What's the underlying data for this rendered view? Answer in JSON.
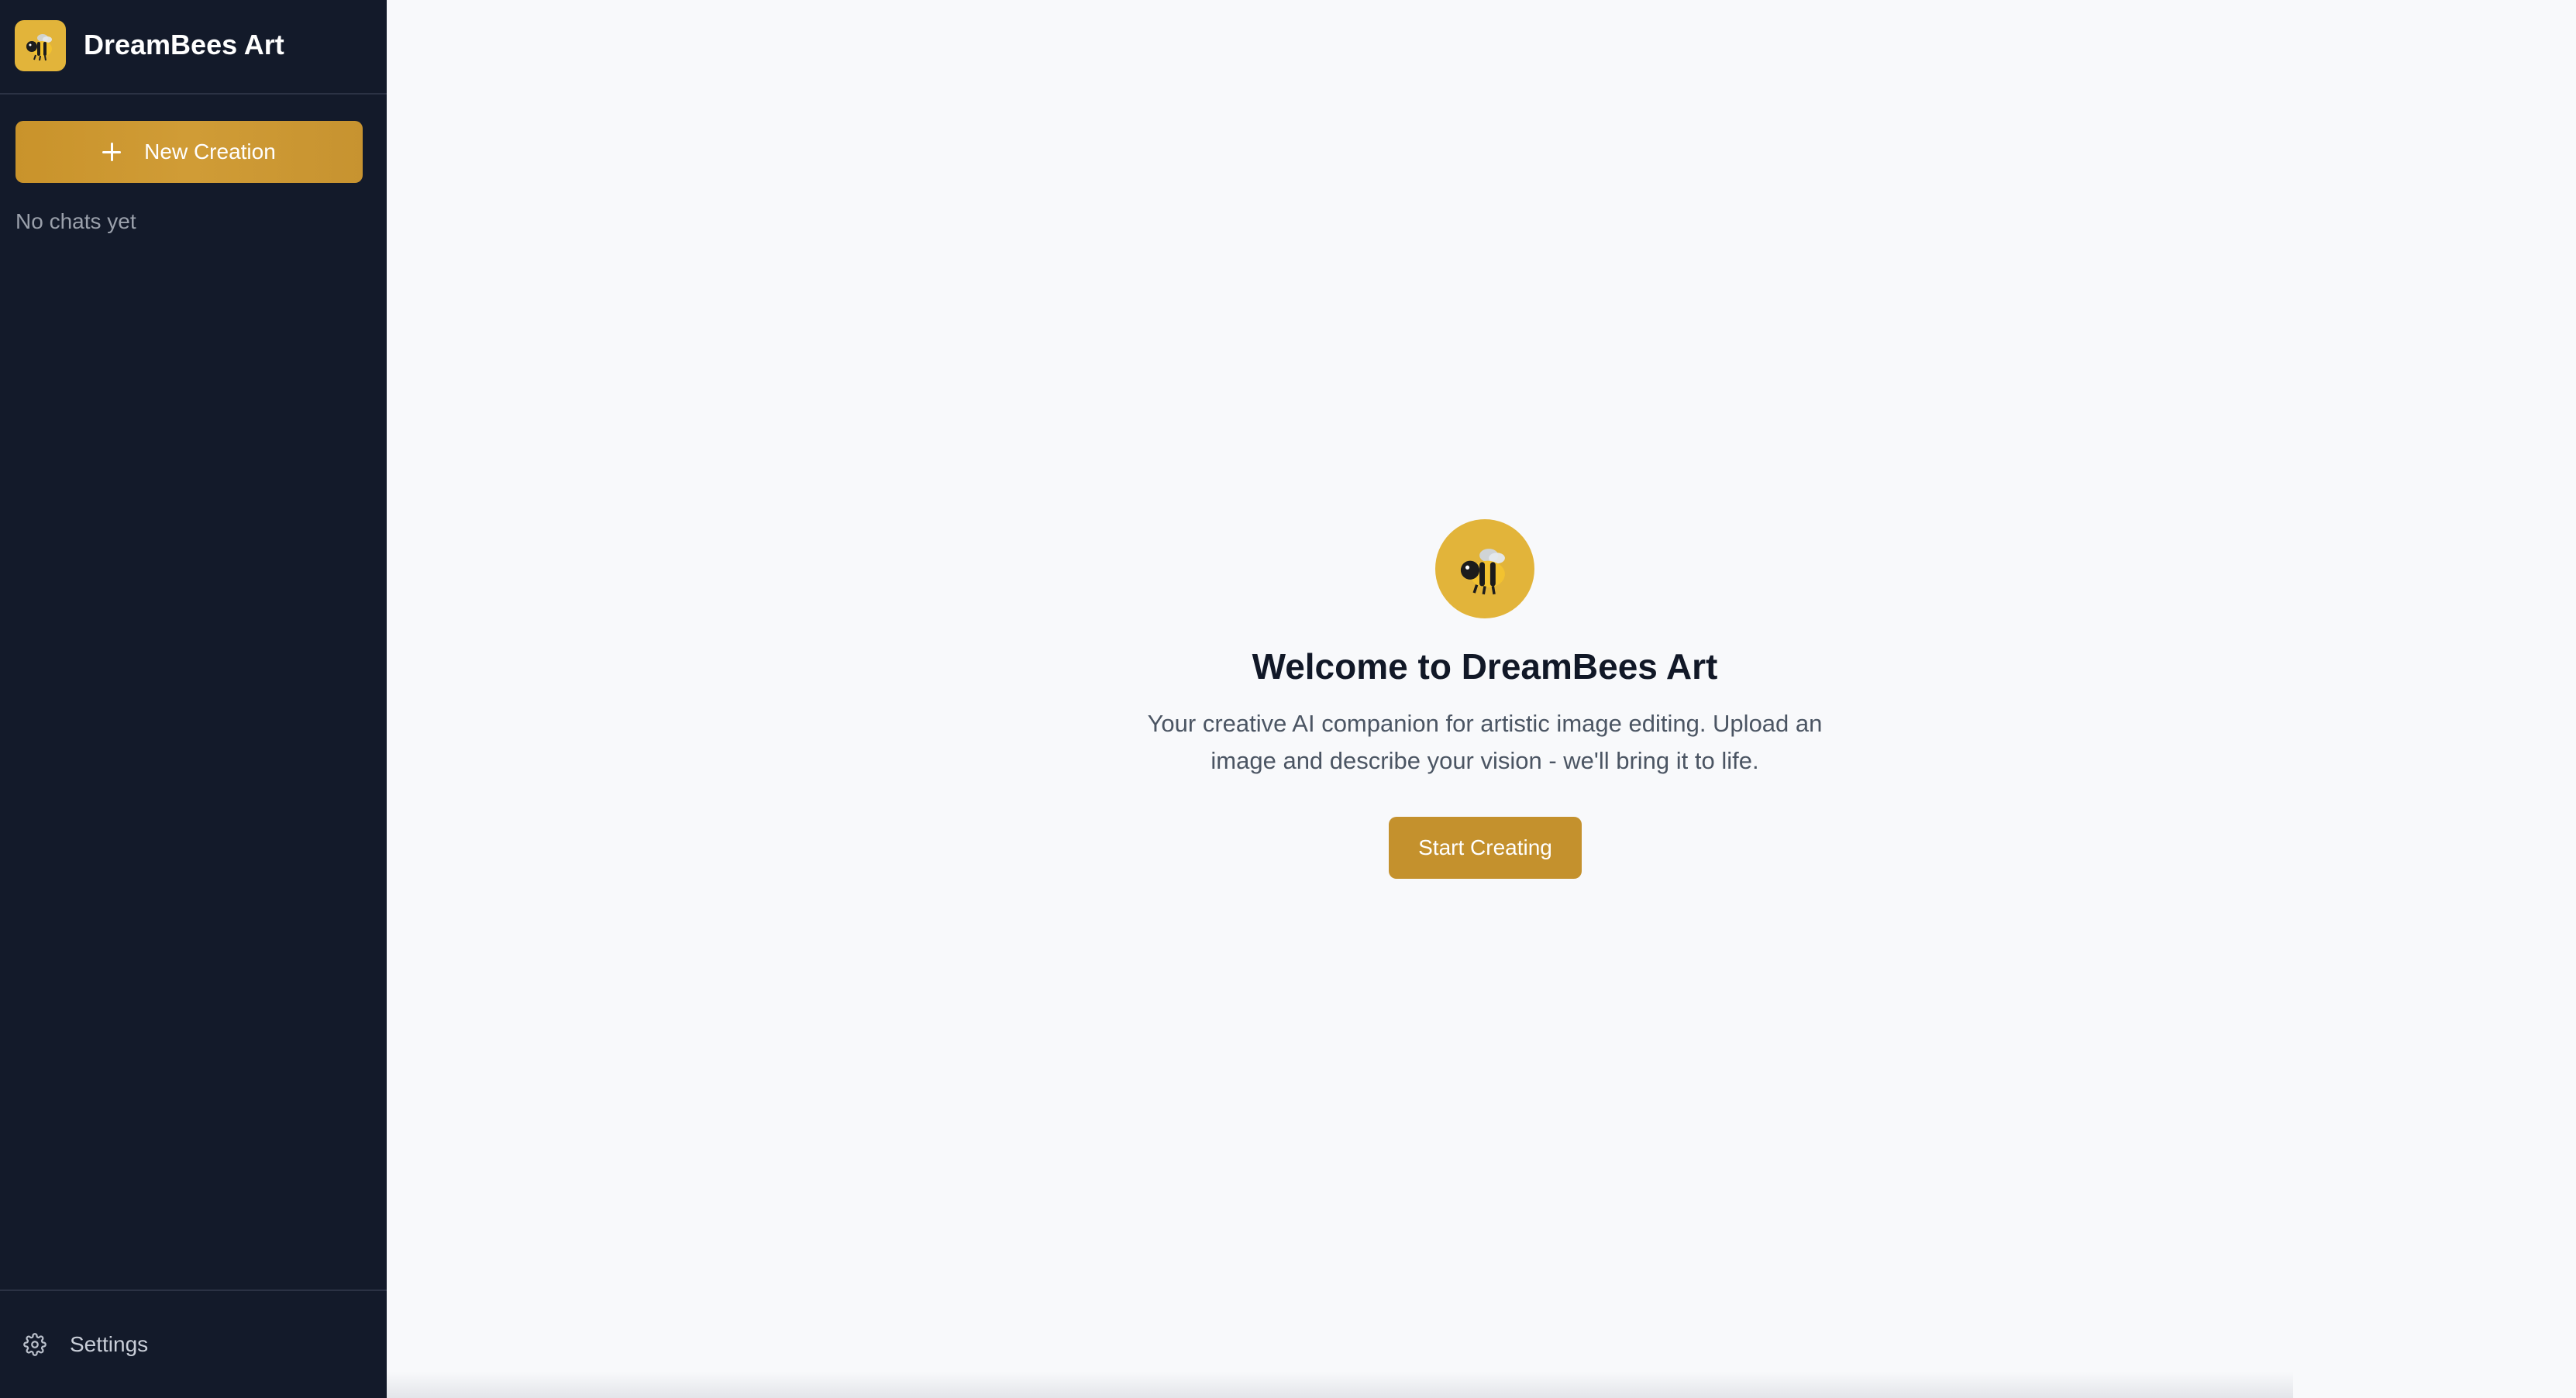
{
  "sidebar": {
    "brand": {
      "title": "DreamBees Art",
      "logo_icon": "bee-icon"
    },
    "new_creation_label": "New Creation",
    "empty_state": "No chats yet",
    "settings_label": "Settings"
  },
  "main": {
    "hero_icon": "bee-icon",
    "title": "Welcome to DreamBees Art",
    "subtitle": "Your creative AI companion for artistic image editing. Upload an image and describe your vision - we'll bring it to life.",
    "cta_label": "Start Creating"
  },
  "colors": {
    "sidebar_bg": "#131a2a",
    "accent": "#c4912d",
    "logo_bg": "#e2b43a",
    "main_bg": "#f8f9fb",
    "title_text": "#111827",
    "subtitle_text": "#4b5563"
  }
}
